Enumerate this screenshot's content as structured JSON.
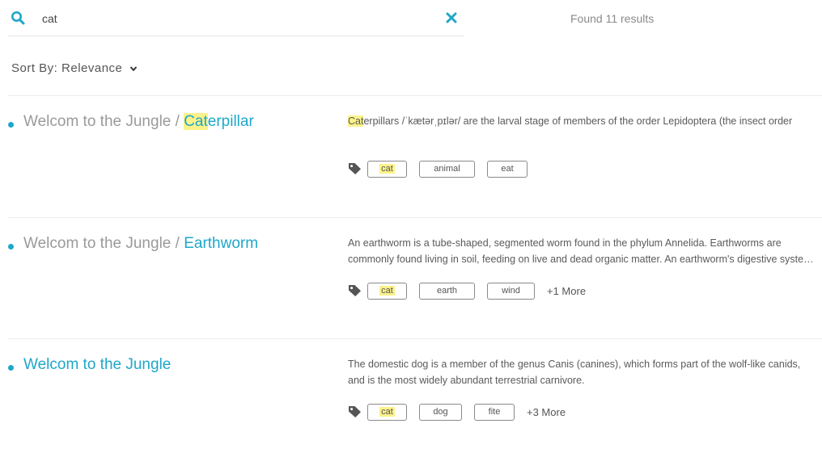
{
  "search": {
    "value": "cat",
    "placeholder": ""
  },
  "results_count": "Found 11 results",
  "sort": {
    "label": "Sort By: Relevance"
  },
  "colors": {
    "accent": "#1fa7c9",
    "highlight": "#fbf28a"
  },
  "results": [
    {
      "title_prefix": "Welcom to the Jungle / ",
      "title_hl": "Cat",
      "title_rest": "erpillar",
      "desc_hl": "Cat",
      "desc": "erpillars /ˈkætərˌpɪlər/ are the larval stage of members of the order Lepidoptera (the insect order",
      "tags": [
        "cat",
        "animal",
        "eat"
      ],
      "more": ""
    },
    {
      "title_prefix": "Welcom to the Jungle / ",
      "title_link": "Earthworm",
      "desc": "An earthworm is a tube-shaped, segmented worm found in the phylum Annelida. Earthworms are commonly found living in soil, feeding on live and dead organic matter. An earthworm's digestive system runs through the length of its body.",
      "tags": [
        "cat",
        "earth",
        "wind"
      ],
      "more": "+1 More"
    },
    {
      "title_link": "Welcom to the Jungle",
      "desc": "The domestic dog is a member of the genus Canis (canines), which forms part of the wolf-like canids, and is the most widely abundant terrestrial carnivore.",
      "tags": [
        "cat",
        "dog",
        "fite"
      ],
      "more": "+3 More"
    }
  ]
}
